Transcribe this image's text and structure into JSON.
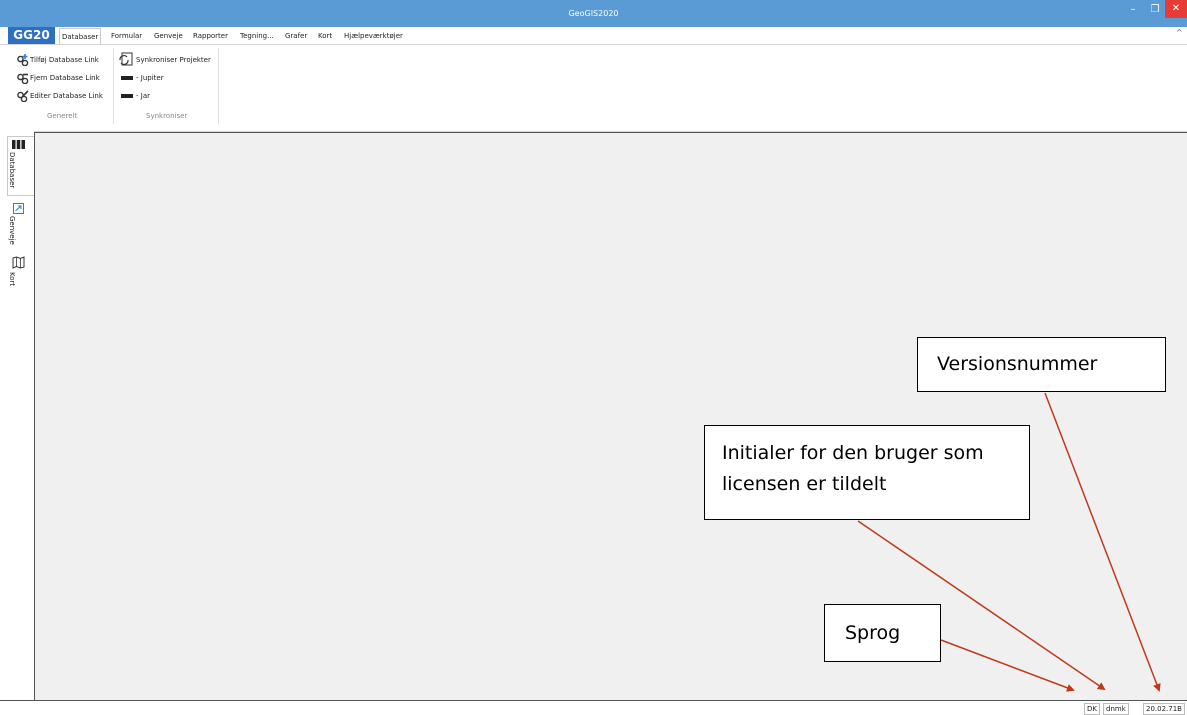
{
  "window": {
    "title": "GeoGIS2020",
    "close_glyph": "✕",
    "minimize_glyph": "–",
    "maximize_glyph": "❐"
  },
  "logo": "GG20",
  "tabs": [
    {
      "label": "Databaser",
      "active": true
    },
    {
      "label": "Formular"
    },
    {
      "label": "Genveje"
    },
    {
      "label": "Rapporter"
    },
    {
      "label": "Tegning..."
    },
    {
      "label": "Grafer"
    },
    {
      "label": "Kort"
    },
    {
      "label": "Hjælpeværktøjer"
    }
  ],
  "ribbon": {
    "generelt": {
      "label": "Generelt",
      "items": [
        "Tilføj Database Link",
        "Fjern Database Link",
        "Editer Database Link"
      ]
    },
    "synkroniser": {
      "label": "Synkroniser",
      "items": [
        "Synkroniser Projekter",
        "- Jupiter",
        "- Jar"
      ]
    }
  },
  "sidebar": [
    "Databaser",
    "Genveje",
    "Kort"
  ],
  "status": {
    "language": "DK",
    "user": "dnmk",
    "version": "20.02.71B"
  },
  "callouts": {
    "version": "Versionsnummer",
    "initials": "Initialer for den bruger som licensen er tildelt",
    "language": "Sprog"
  },
  "colors": {
    "titlebar": "#5b9bd5",
    "logo": "#2d6fc0",
    "arrow": "#c0391b",
    "canvas": "#f0f0f0"
  }
}
